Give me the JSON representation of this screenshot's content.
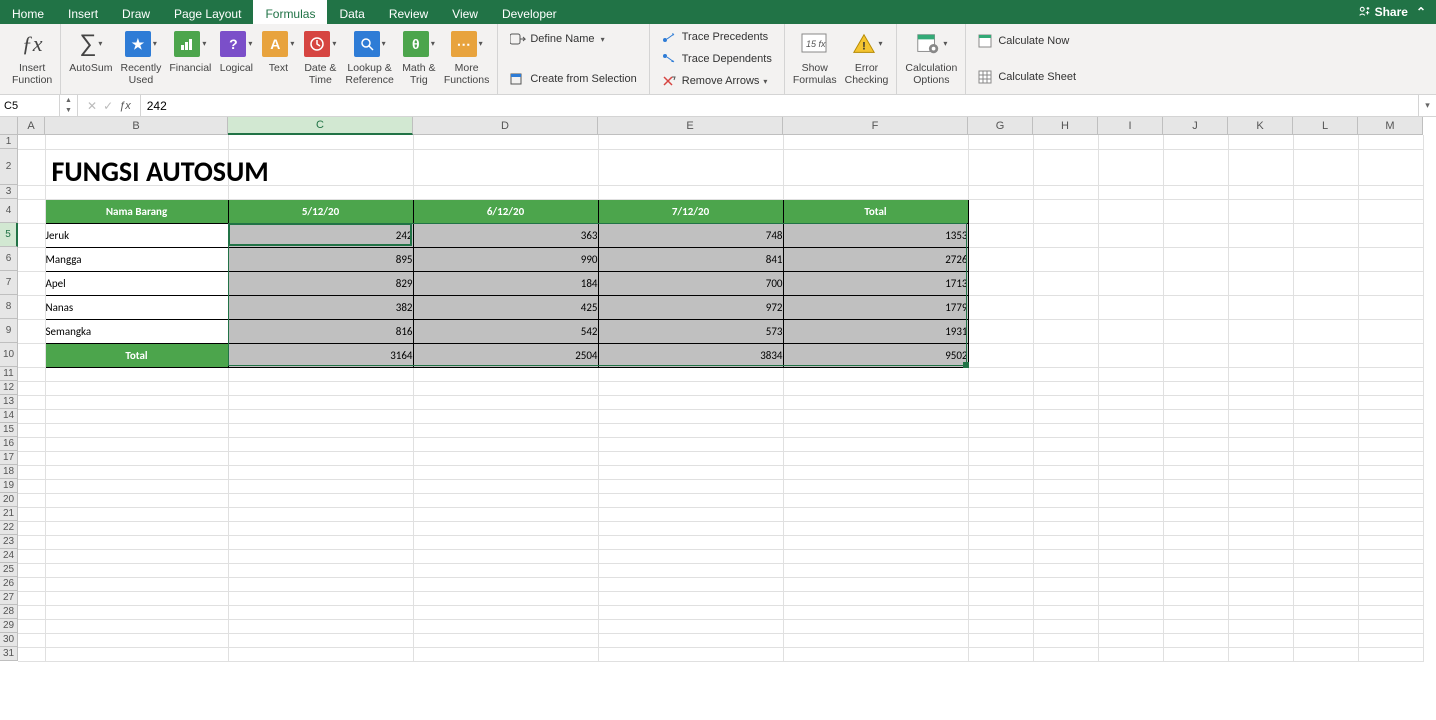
{
  "tabs": [
    "Home",
    "Insert",
    "Draw",
    "Page Layout",
    "Formulas",
    "Data",
    "Review",
    "View",
    "Developer"
  ],
  "active_tab": "Formulas",
  "share_label": "Share",
  "ribbon": {
    "insert_function": "Insert\nFunction",
    "autosum": "AutoSum",
    "recently_used": "Recently\nUsed",
    "financial": "Financial",
    "logical": "Logical",
    "text": "Text",
    "date_time": "Date &\nTime",
    "lookup_ref": "Lookup &\nReference",
    "math_trig": "Math &\nTrig",
    "more_functions": "More\nFunctions",
    "define_name": "Define Name",
    "create_from_selection": "Create from Selection",
    "trace_precedents": "Trace Precedents",
    "trace_dependents": "Trace Dependents",
    "remove_arrows": "Remove Arrows",
    "show_formulas": "Show\nFormulas",
    "error_checking": "Error\nChecking",
    "calculation_options": "Calculation\nOptions",
    "calculate_now": "Calculate Now",
    "calculate_sheet": "Calculate Sheet"
  },
  "name_box": "C5",
  "formula_value": "242",
  "columns": [
    "A",
    "B",
    "C",
    "D",
    "E",
    "F",
    "G",
    "H",
    "I",
    "J",
    "K",
    "L",
    "M"
  ],
  "selected_col": "C",
  "selected_row": 5,
  "col_widths": {
    "A": 27,
    "B": 183,
    "C": 185,
    "D": 185,
    "E": 185,
    "F": 185,
    "G": 65,
    "H": 65,
    "I": 65,
    "J": 65,
    "K": 65,
    "L": 65,
    "M": 65
  },
  "row_heights": {
    "1": 14,
    "2": 36,
    "3": 14,
    "4": 24,
    "5": 24,
    "6": 24,
    "7": 24,
    "8": 24,
    "9": 24,
    "10": 24
  },
  "default_row_height": 14,
  "sheet": {
    "title": "FUNGSI AUTOSUM",
    "headers": [
      "Nama Barang",
      "5/12/20",
      "6/12/20",
      "7/12/20",
      "Total"
    ],
    "rows": [
      {
        "name": "Jeruk",
        "d1": 242,
        "d2": 363,
        "d3": 748,
        "total": 1353
      },
      {
        "name": "Mangga",
        "d1": 895,
        "d2": 990,
        "d3": 841,
        "total": 2726
      },
      {
        "name": "Apel",
        "d1": 829,
        "d2": 184,
        "d3": 700,
        "total": 1713
      },
      {
        "name": "Nanas",
        "d1": 382,
        "d2": 425,
        "d3": 972,
        "total": 1779
      },
      {
        "name": "Semangka",
        "d1": 816,
        "d2": 542,
        "d3": 573,
        "total": 1931
      }
    ],
    "total_row": {
      "label": "Total",
      "d1": 3164,
      "d2": 2504,
      "d3": 3834,
      "total": 9502
    }
  },
  "num_rows": 31
}
